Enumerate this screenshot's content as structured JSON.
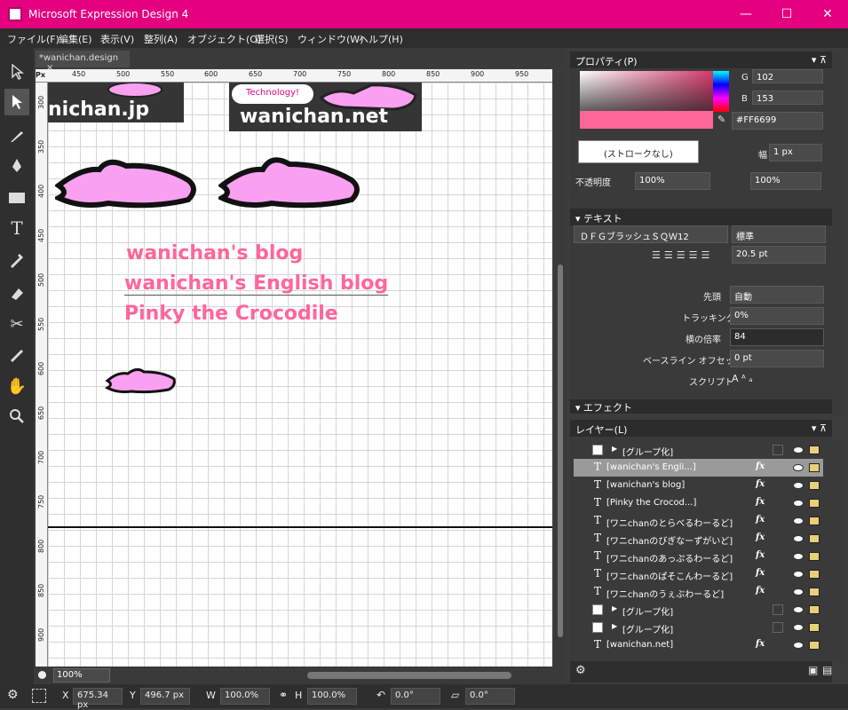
{
  "window": {
    "title": "Microsoft Expression Design 4",
    "min": "—",
    "max": "☐",
    "close": "✕"
  },
  "menu": [
    "ファイル(F)",
    "編集(E)",
    "表示(V)",
    "整列(A)",
    "オブジェクト(O)",
    "選択(S)",
    "ウィンドウ(W)",
    "ヘルプ(H)"
  ],
  "doc": {
    "tab": "*wanichan.design",
    "close": "×"
  },
  "ruler": {
    "unit": "Px",
    "top": [
      "450",
      "500",
      "550",
      "600",
      "650",
      "700",
      "750",
      "800",
      "850",
      "900",
      "950"
    ],
    "left": [
      "300",
      "350",
      "400",
      "450",
      "500",
      "550",
      "600",
      "650",
      "700",
      "750",
      "800",
      "850",
      "900"
    ]
  },
  "canvas": {
    "logo1": "nichan.jp",
    "logo2": "wanichan.net",
    "bubble": "Technology!",
    "texts": [
      "wanichan's blog",
      "wanichan's English blog",
      "Pinky the Crocodile"
    ]
  },
  "zoom": "100%",
  "status": {
    "x_label": "X",
    "x": "675.34 px",
    "y_label": "Y",
    "y": "496.7 px",
    "w_label": "W",
    "w": "100.0%",
    "h_label": "H",
    "h": "100.0%",
    "rot": "0.0°",
    "skew": "0.0°"
  },
  "props": {
    "title": "プロパティ(P)",
    "g_label": "G",
    "g": "102",
    "b_label": "B",
    "b": "153",
    "hex": "#FF6699",
    "stroke": "(ストロークなし)",
    "width_label": "幅",
    "width": "1 px",
    "opacity_label": "不透明度",
    "opacity": "100%",
    "opacity2": "100%",
    "text_head": "テキスト",
    "font": "ＤＦＧブラッシュＳＱＷ12",
    "style": "標準",
    "size": "20.5 pt",
    "leading_label": "先頭",
    "leading": "自動",
    "tracking_label": "トラッキング",
    "tracking": "0%",
    "hscale_label": "横の倍率",
    "hscale": "84",
    "baseline_label": "ベースライン オフセット",
    "baseline": "0 pt",
    "script_label": "スクリプト",
    "effect_head": "エフェクト"
  },
  "layers": {
    "title": "レイヤー(L)",
    "rows": [
      {
        "name": "[グループ化]",
        "kind": "group"
      },
      {
        "name": "[wanichan's Engli...]",
        "kind": "text",
        "sel": true
      },
      {
        "name": "[wanichan's blog]",
        "kind": "text"
      },
      {
        "name": "[Pinky the Crocod...]",
        "kind": "text"
      },
      {
        "name": "[ワニchanのとらべるわーるど]",
        "kind": "text"
      },
      {
        "name": "[ワニchanのびぎなーずがいど]",
        "kind": "text"
      },
      {
        "name": "[ワニchanのあっぷるわーるど]",
        "kind": "text"
      },
      {
        "name": "[ワニchanのぱそこんわーるど]",
        "kind": "text"
      },
      {
        "name": "[ワニchanのうぇぶわーるど]",
        "kind": "text"
      },
      {
        "name": "[グループ化]",
        "kind": "group"
      },
      {
        "name": "[グループ化]",
        "kind": "group"
      },
      {
        "name": "[wanichan.net]",
        "kind": "text"
      }
    ]
  },
  "colors": {
    "accent": "#E4007F",
    "fill": "#FF6699",
    "croc": "#F9A0F0"
  }
}
